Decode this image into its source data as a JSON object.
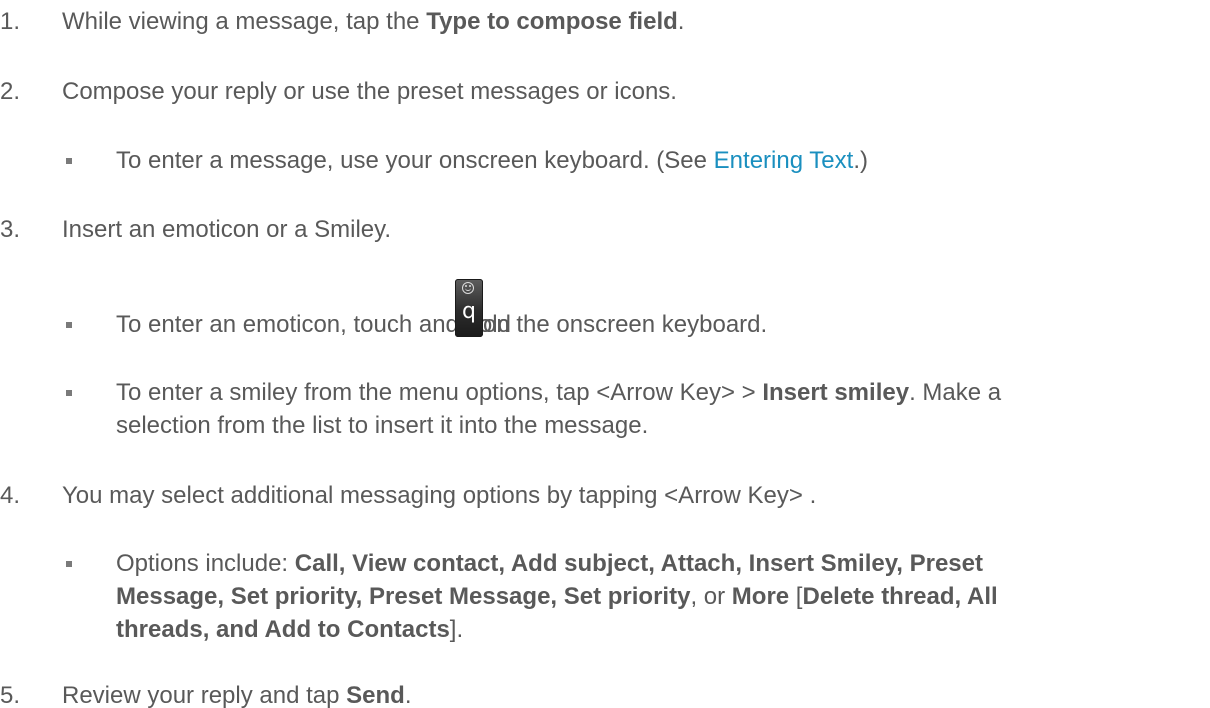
{
  "steps": [
    {
      "number": "1.",
      "parts": [
        "While viewing a message, tap the ",
        "Type to compose field",
        "."
      ]
    },
    {
      "number": "2.",
      "text": "Compose your reply or use the preset messages or icons.",
      "bullets": [
        {
          "before": "To enter a message, use your onscreen keyboard. (See ",
          "link": "Entering Text",
          "after": ".)"
        }
      ]
    },
    {
      "number": "3.",
      "text": "Insert an emoticon or a Smiley.",
      "bullets": [
        {
          "before": "To enter an emoticon, touch and hold ",
          "key_label": "q",
          "key_icon": "emoticon-q-key-icon",
          "after": " on the onscreen keyboard."
        },
        {
          "line1": "To enter a smiley from the menu options, tap <Arrow Key> > ",
          "bold": "Insert smiley",
          "line1_after": ". Make a",
          "line2": "selection from the list to insert it into the message."
        }
      ]
    },
    {
      "number": "4.",
      "text": "You may select additional messaging options by tapping <Arrow Key> .",
      "bullets": [
        {
          "prefix": "Options include: ",
          "line1_bold": "Call, View contact, Add subject, Attach, Insert Smiley, Preset",
          "line2_bold_a": "Message, Set priority, Preset Message, Set priority",
          "line2_mid": ", or ",
          "line2_bold_b": "More",
          "line2_bracket": " [",
          "line2_bold_c": "Delete thread, All",
          "line3_bold": "threads, and Add to Contacts",
          "line3_end": "]."
        }
      ]
    },
    {
      "number": "5.",
      "parts": [
        "Review your reply and tap ",
        "Send",
        "."
      ]
    }
  ]
}
